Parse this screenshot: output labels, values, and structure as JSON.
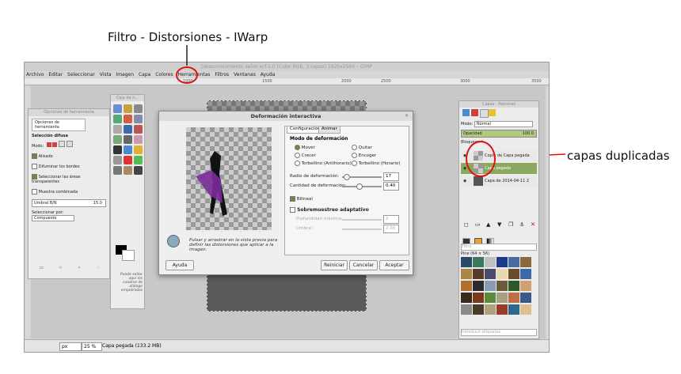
{
  "annotations": {
    "top_caption": "Filtro - Distorsiones - IWarp",
    "right_caption": "capas duplicadas"
  },
  "gimp": {
    "window_title": "[desconocimiento señor.xcf-1.0 (Color RGB, 3 capas) 1920x2560 – GIMP",
    "menu": [
      "Archivo",
      "Editar",
      "Seleccionar",
      "Vista",
      "Imagen",
      "Capa",
      "Colores",
      "Herramientas",
      "Filtros",
      "Ventanas",
      "Ayuda"
    ],
    "ruler_ticks": [
      "1000",
      "1500",
      "2000",
      "2500",
      "3000",
      "3500"
    ],
    "status": {
      "unit": "px",
      "zoom": "25 %",
      "message": "Capa pegada (133.2 MB)"
    }
  },
  "tool_options": {
    "title": "Opciones de herramienta",
    "tab": "Opciones de herramienta",
    "section": "Selección difusa",
    "mode_label": "Modo:",
    "antialias": "Alisado",
    "feather": "Difuminar los bordes",
    "select_transparent": "Seleccionar las áreas transparentes",
    "sample_merged": "Muestra combinada",
    "threshold_label": "Umbral B/N",
    "threshold_value": "15.0",
    "select_by_label": "Seleccionar por:",
    "select_by_value": "Compuesto"
  },
  "toolbox": {
    "title": "Caja de h...",
    "hint": "Puede soltar aquí los cuadros de diálogo empotrados"
  },
  "dialog": {
    "title": "Deformación interactiva",
    "tabs": [
      "Configuración",
      "Animar"
    ],
    "mode_heading": "Modo de deformación",
    "modes": [
      "Mover",
      "Quitar",
      "Crecer",
      "Encoger",
      "Torbellino (Antihorario)",
      "Torbellino (Horario)"
    ],
    "radius_label": "Radio de deformación:",
    "radius_value": "17",
    "amount_label": "Cantidad de deformación:",
    "amount_value": "0.40",
    "bilinear": "Bilineal",
    "supersample_heading": "Sobremuestreo adaptativo",
    "max_depth_label": "Profundidad máxima:",
    "max_depth_value": "3",
    "threshold_label": "Umbral:",
    "threshold_value": "2.00",
    "hint": "Pulsar y arrastrar en la vista previa para definir las distorsiones que aplicar a la imagen.",
    "help": "Ayuda",
    "reset": "Reiniciar",
    "cancel": "Cancelar",
    "ok": "Aceptar"
  },
  "layers": {
    "title": "Capas - Patrones",
    "mode_label": "Modo:",
    "mode_value": "Normal",
    "opacity_label": "Opacidad",
    "opacity_value": "100.0",
    "lock_label": "Bloquear:",
    "items": [
      "Copia de Capa pegada",
      "Capa pegada",
      "Capa de 2014-04-11 2"
    ],
    "patterns_label": "Pine (64 × 56)",
    "search_placeholder": "Filtro",
    "tag_placeholder": "Introducir etiquetas"
  }
}
